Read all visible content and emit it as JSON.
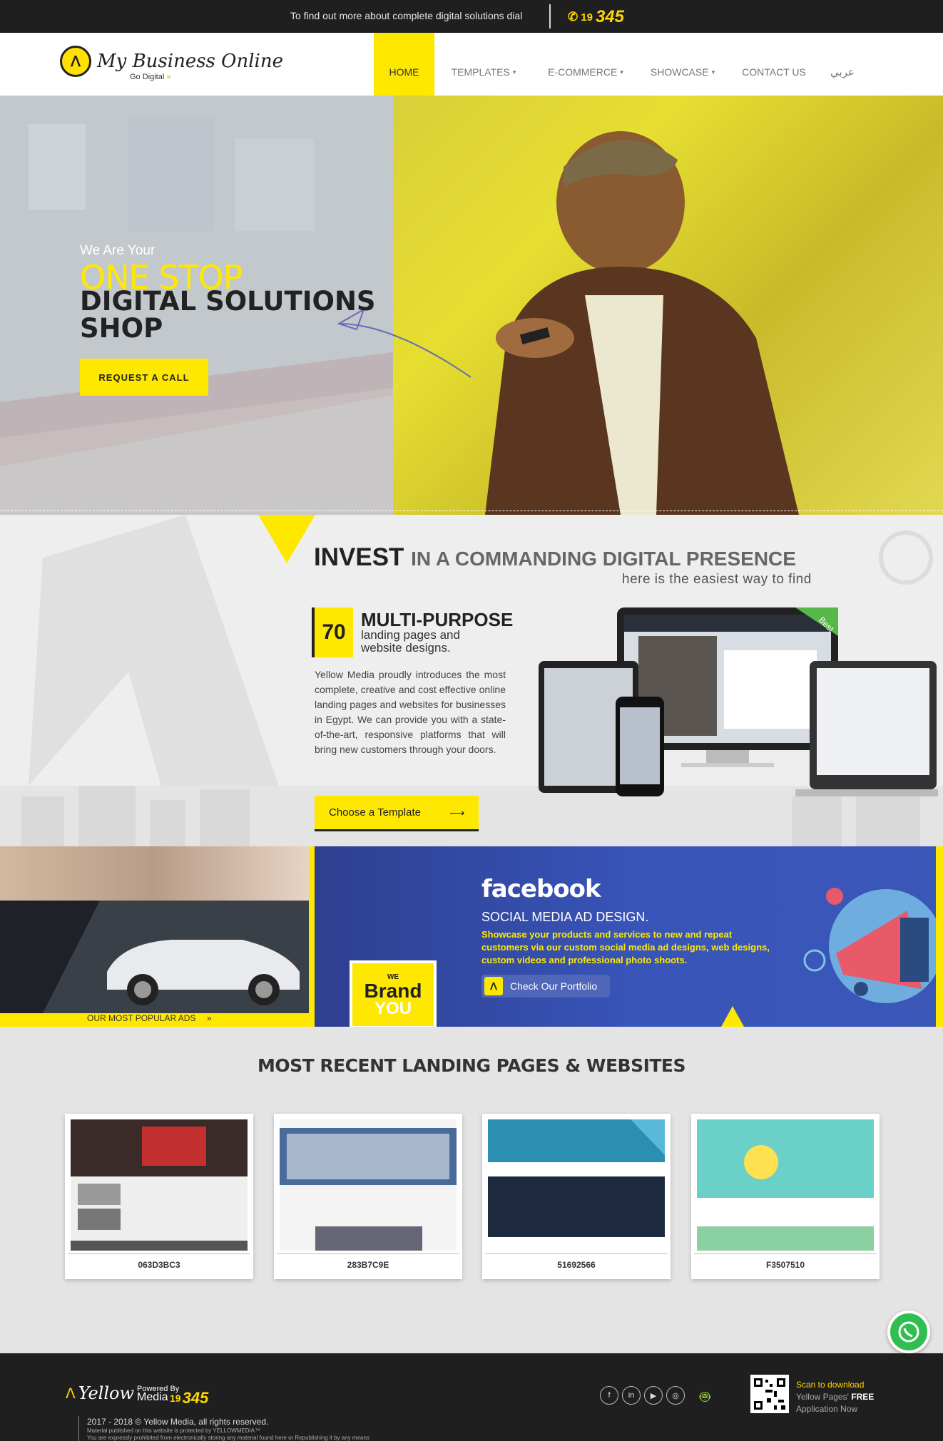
{
  "topbar": {
    "text": "To find out more about complete digital solutions dial",
    "phone_prefix": "19",
    "phone_main": "345"
  },
  "header": {
    "logo_title": "My Business Online",
    "logo_sub": "Go Digital",
    "logo_sub_accent": "»",
    "nav": [
      {
        "label": "HOME",
        "caret": ""
      },
      {
        "label": "TEMPLATES",
        "caret": "▾"
      },
      {
        "label": "E-COMMERCE",
        "caret": "▾"
      },
      {
        "label": "SHOWCASE",
        "caret": "▾"
      },
      {
        "label": "CONTACT US",
        "caret": ""
      },
      {
        "label": "عربي",
        "caret": ""
      }
    ]
  },
  "hero": {
    "subtitle": "We Are Your",
    "title_accent": "ONE STOP",
    "title_line2": "DIGITAL SOLUTIONS",
    "title_line3": "SHOP",
    "button": "REQUEST A CALL"
  },
  "invest": {
    "title_bold": "INVEST",
    "title_rest": "IN A COMMANDING DIGITAL PRESENCE",
    "subtitle": "here is the easiest way to find",
    "count": "70",
    "mp_title": "MULTI-PURPOSE",
    "mp_sub": "landing pages and website designs.",
    "body": "Yellow Media proudly introduces the most complete, creative and cost effective online landing pages and websites for businesses in Egypt. We can provide you with a state-of-the-art, responsive platforms that will bring new customers through your doors.",
    "button": "Choose a Template",
    "button_arrow": "⟶",
    "device_tag": "Best"
  },
  "ads": {
    "left_label": "OUR MOST POPULAR ADS",
    "left_label_arrow": "»",
    "fb_logo": "facebook",
    "fb_title": "SOCIAL MEDIA AD DESIGN.",
    "fb_desc": "Showcase your products and services to new and repeat customers via our custom social media ad designs, web designs, custom videos and professional photo shoots.",
    "fb_button": "Check Our Portfolio",
    "brand_we": "WE",
    "brand_brand": "Brand",
    "brand_you": "YOU"
  },
  "recent": {
    "title": "MOST RECENT LANDING PAGES & WEBSITES",
    "cards": [
      {
        "label": "063D3BC3"
      },
      {
        "label": "283B7C9E"
      },
      {
        "label": "51692566"
      },
      {
        "label": "F3507510"
      }
    ]
  },
  "footer": {
    "logo": "Yellow",
    "powered": "Powered By",
    "media": "Media",
    "phone_prefix": "19",
    "phone_main": "345",
    "copyright": "2017 - 2018 © Yellow Media, all rights reserved.",
    "small1": "Material published on this website is protected by YELLOWMEDIA™",
    "small2": "You are expressly prohibited from electronically storing any material found here or Republishing it by any means",
    "scan_line1": "Scan to download",
    "scan_line2": "Yellow Pages'",
    "scan_line2_bold": "FREE",
    "scan_line3": "Application Now"
  },
  "colors": {
    "accent": "#ffe800",
    "dark": "#1f1f1f",
    "facebook_blue": "#3854b8"
  }
}
